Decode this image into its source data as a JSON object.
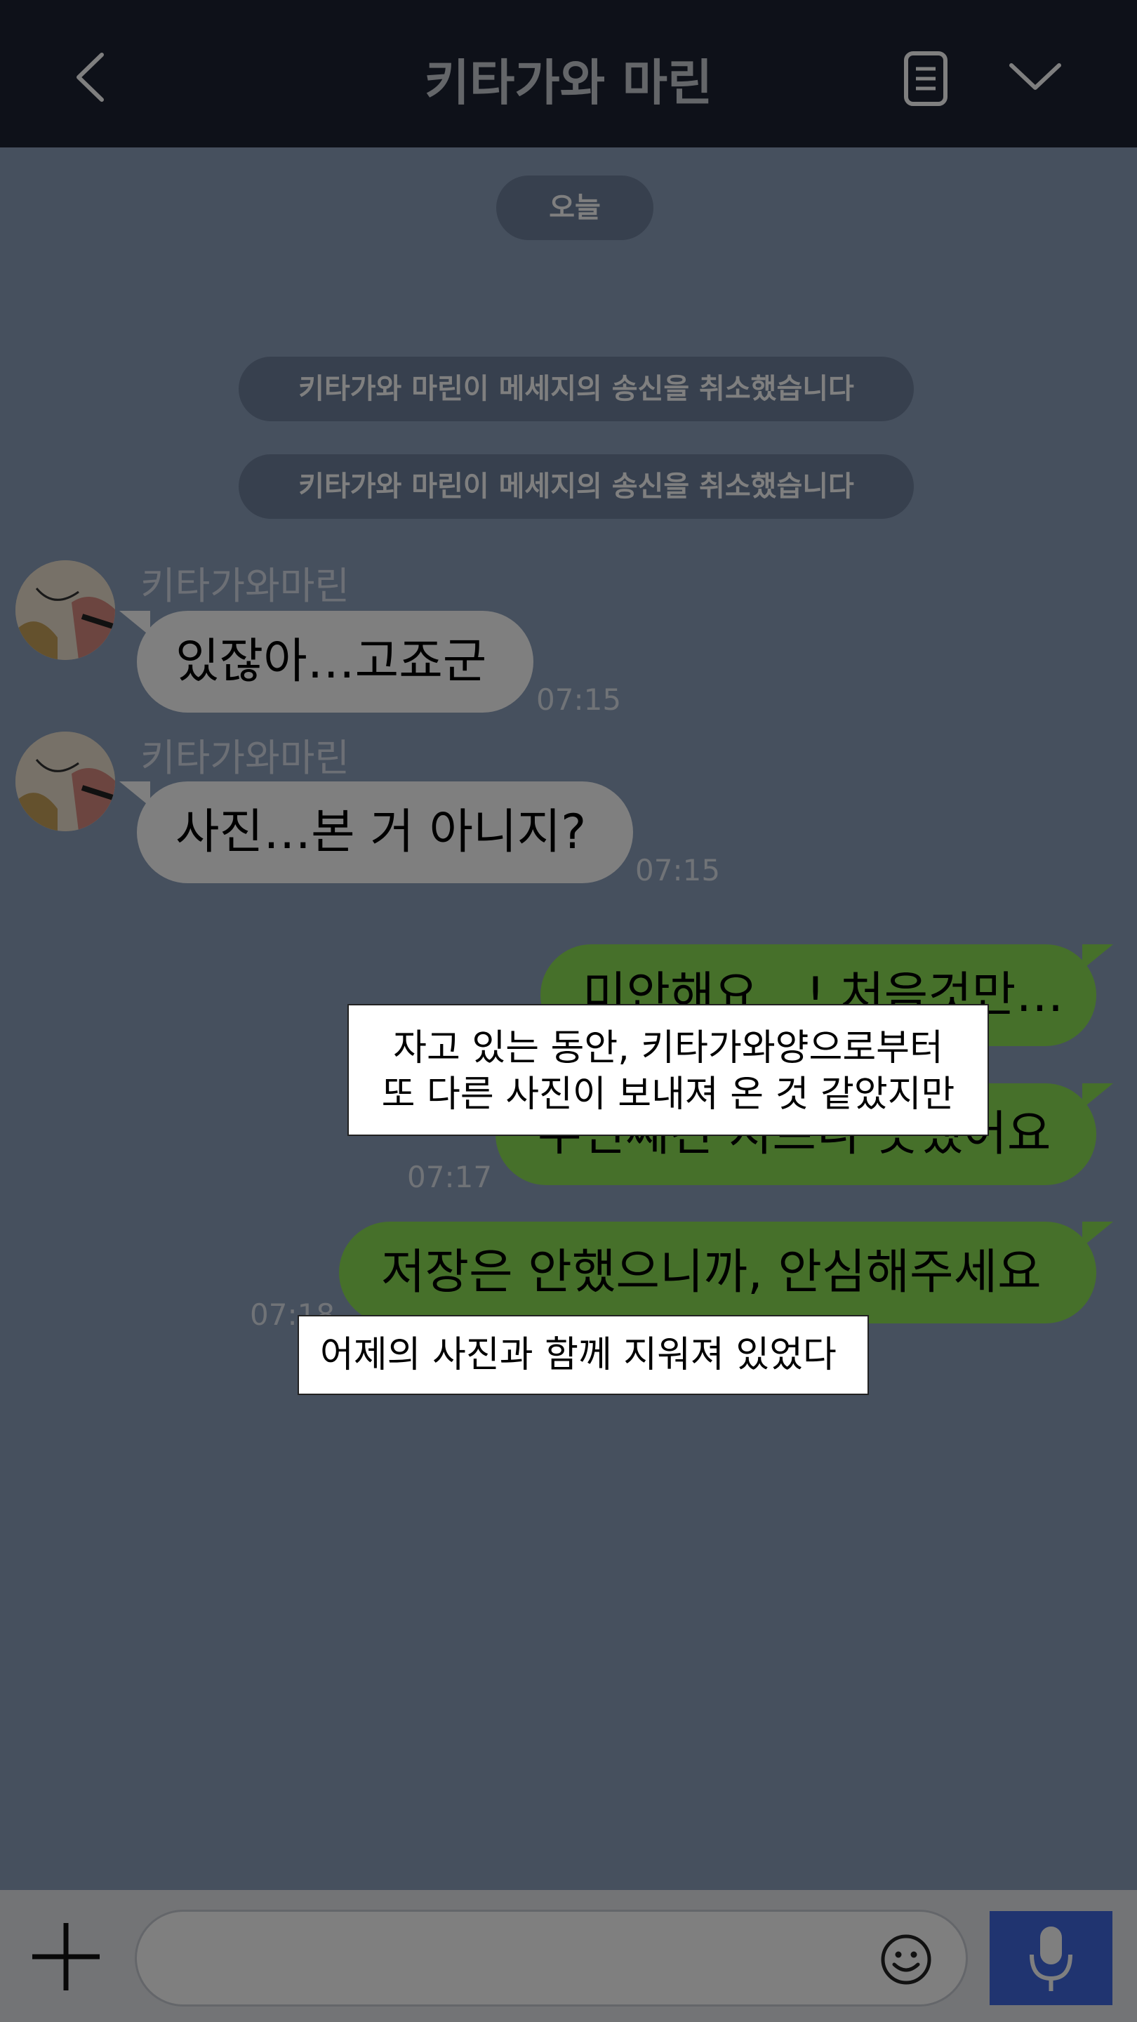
{
  "header": {
    "title": "키타가와 마린"
  },
  "chat": {
    "date_pill": "오늘",
    "system_messages": [
      "키타가와 마린이 메세지의 송신을 취소했습니다",
      "키타가와 마린이 메세지의 송신을 취소했습니다"
    ],
    "messages": [
      {
        "sender": "키타가와마린",
        "text": "있잖아…고죠군",
        "time": "07:15"
      },
      {
        "sender": "키타가와마린",
        "text": "사진…본 거 아니지?",
        "time": "07:15"
      },
      {
        "text": "미안해요…! 처음것만…",
        "time": ""
      },
      {
        "text": "두번째건 지르니 못했어요",
        "time": "07:17"
      },
      {
        "text": "저장은 안했으니까, 안심해주세요",
        "time": "07:18"
      }
    ]
  },
  "captions": {
    "caption_1_line_1": "자고 있는 동안, 키타가와양으로부터",
    "caption_1_line_2": "또 다른 사진이 보내져 온 것 같았지만",
    "caption_2": "어제의 사진과 함께 지워져 있었다"
  },
  "colors": {
    "header_bg": "#1c2233",
    "chat_bg": "#8da0bd",
    "sent_bubble": "#8de055",
    "received_bubble": "#ffffff",
    "mic_button": "#4169e1"
  },
  "icons": [
    "back-icon",
    "document-icon",
    "chevron-down-icon",
    "plus-icon",
    "emoji-icon",
    "microphone-icon"
  ]
}
